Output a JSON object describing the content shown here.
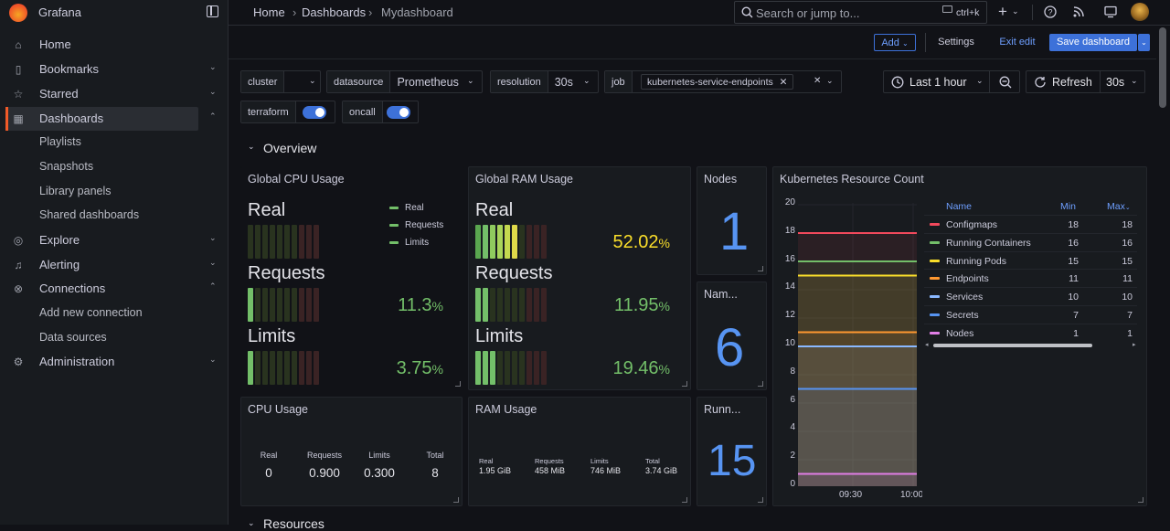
{
  "app": {
    "title": "Grafana"
  },
  "sidebar": {
    "items": [
      {
        "label": "Home",
        "icon": "home-icon",
        "chevron": ""
      },
      {
        "label": "Bookmarks",
        "icon": "bookmark-icon",
        "chevron": "⌄"
      },
      {
        "label": "Starred",
        "icon": "star-icon",
        "chevron": "⌄"
      },
      {
        "label": "Dashboards",
        "icon": "dashboards-icon",
        "chevron": "⌃"
      },
      {
        "label": "Playlists",
        "icon": "",
        "chevron": ""
      },
      {
        "label": "Snapshots",
        "icon": "",
        "chevron": ""
      },
      {
        "label": "Library panels",
        "icon": "",
        "chevron": ""
      },
      {
        "label": "Shared dashboards",
        "icon": "",
        "chevron": ""
      },
      {
        "label": "Explore",
        "icon": "compass-icon",
        "chevron": "⌄"
      },
      {
        "label": "Alerting",
        "icon": "bell-icon",
        "chevron": "⌄"
      },
      {
        "label": "Connections",
        "icon": "link-icon",
        "chevron": "⌃"
      },
      {
        "label": "Add new connection",
        "icon": "",
        "chevron": ""
      },
      {
        "label": "Data sources",
        "icon": "",
        "chevron": ""
      },
      {
        "label": "Administration",
        "icon": "gear-icon",
        "chevron": "⌄"
      }
    ]
  },
  "breadcrumb": {
    "home": "Home",
    "dashboards": "Dashboards",
    "current": "Mydashboard",
    "sep": "›"
  },
  "search": {
    "placeholder": "Search or jump to...",
    "shortcut": "ctrl+k"
  },
  "toolbar": {
    "add": "Add",
    "settings": "Settings",
    "exit_edit": "Exit edit",
    "save": "Save dashboard"
  },
  "variables": {
    "cluster": {
      "label": "cluster",
      "value": ""
    },
    "datasource": {
      "label": "datasource",
      "value": "Prometheus"
    },
    "resolution": {
      "label": "resolution",
      "value": "30s"
    },
    "job": {
      "label": "job",
      "value": "kubernetes-service-endpoints"
    },
    "terraform": {
      "label": "terraform"
    },
    "oncall": {
      "label": "oncall"
    }
  },
  "time": {
    "range": "Last 1 hour",
    "refresh": "Refresh",
    "interval": "30s"
  },
  "rows": {
    "overview": "Overview",
    "resources": "Resources"
  },
  "panels": {
    "cpu_global": {
      "title": "Global CPU Usage",
      "gauges": [
        {
          "label": "Real",
          "value": "",
          "lit": 0,
          "color": "#73bf69"
        },
        {
          "label": "Requests",
          "value": "11.3",
          "unit": "%",
          "lit": 1,
          "color": "#73bf69"
        },
        {
          "label": "Limits",
          "value": "3.75",
          "unit": "%",
          "lit": 1,
          "color": "#73bf69"
        }
      ],
      "legend": [
        "Real",
        "Requests",
        "Limits"
      ]
    },
    "ram_global": {
      "title": "Global RAM Usage",
      "gauges": [
        {
          "label": "Real",
          "value": "52.02",
          "unit": "%",
          "lit": 6,
          "color": "#fade2a"
        },
        {
          "label": "Requests",
          "value": "11.95",
          "unit": "%",
          "lit": 2,
          "color": "#73bf69"
        },
        {
          "label": "Limits",
          "value": "19.46",
          "unit": "%",
          "lit": 3,
          "color": "#73bf69"
        }
      ]
    },
    "nodes": {
      "title": "Nodes",
      "value": "1"
    },
    "namespaces": {
      "title": "Nam...",
      "value": "6"
    },
    "running": {
      "title": "Runn...",
      "value": "15"
    },
    "cpu_usage": {
      "title": "CPU Usage",
      "stats": [
        {
          "label": "Real",
          "value": "0"
        },
        {
          "label": "Requests",
          "value": "0.900"
        },
        {
          "label": "Limits",
          "value": "0.300"
        },
        {
          "label": "Total",
          "value": "8"
        }
      ]
    },
    "ram_usage": {
      "title": "RAM Usage",
      "stats": [
        {
          "label": "Real",
          "value": "1.95 GiB"
        },
        {
          "label": "Requests",
          "value": "458 MiB"
        },
        {
          "label": "Limits",
          "value": "746 MiB"
        },
        {
          "label": "Total",
          "value": "3.74 GiB"
        }
      ]
    },
    "k8s": {
      "title": "Kubernetes Resource Count",
      "columns": {
        "name": "Name",
        "min": "Min",
        "max": "Max"
      }
    }
  },
  "chart_data": {
    "type": "line",
    "title": "Kubernetes Resource Count",
    "x": [
      "09:30",
      "10:00"
    ],
    "ylim": [
      0,
      20
    ],
    "yticks": [
      "20",
      "18",
      "16",
      "14",
      "12",
      "10",
      "8",
      "6",
      "4",
      "2",
      "0"
    ],
    "series": [
      {
        "name": "Configmaps",
        "color": "#f2495c",
        "values": [
          18,
          18
        ],
        "min": "18",
        "max": "18"
      },
      {
        "name": "Running Containers",
        "color": "#73bf69",
        "values": [
          16,
          16
        ],
        "min": "16",
        "max": "16"
      },
      {
        "name": "Running Pods",
        "color": "#fade2a",
        "values": [
          15,
          15
        ],
        "min": "15",
        "max": "15"
      },
      {
        "name": "Endpoints",
        "color": "#ff9830",
        "values": [
          11,
          11
        ],
        "min": "11",
        "max": "11"
      },
      {
        "name": "Services",
        "color": "#8ab8ff",
        "values": [
          10,
          10
        ],
        "min": "10",
        "max": "10"
      },
      {
        "name": "Secrets",
        "color": "#5794f2",
        "values": [
          7,
          7
        ],
        "min": "7",
        "max": "7"
      },
      {
        "name": "Nodes",
        "color": "#e07ee6",
        "values": [
          1,
          1
        ],
        "min": "1",
        "max": "1"
      }
    ]
  }
}
